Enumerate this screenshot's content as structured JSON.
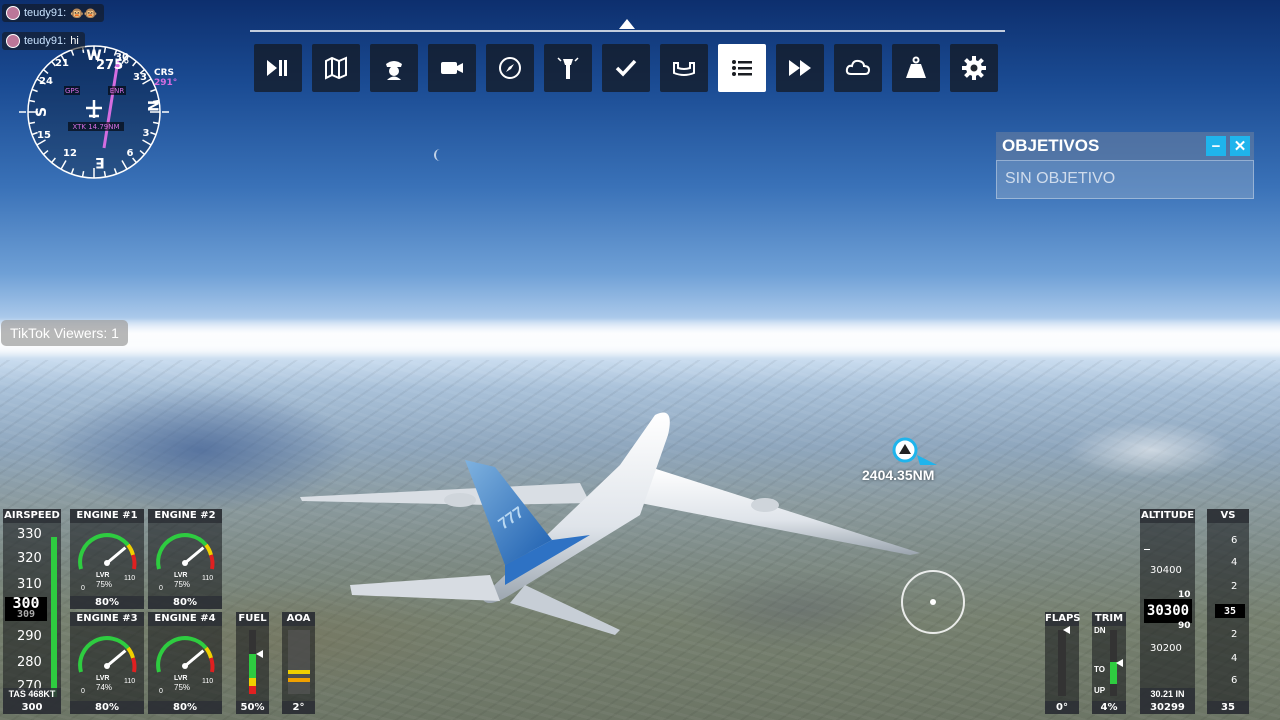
{
  "chat": [
    {
      "user": "teudy91:",
      "text": "🐵🐵"
    },
    {
      "user": "teudy91:",
      "text": "hi"
    }
  ],
  "compass": {
    "heading": "275°",
    "crs_label": "CRS",
    "crs_value": "291°",
    "gps": "GPS",
    "enr": "ENR",
    "xtk": "XTK 14.79NM",
    "cardinals": [
      "N",
      "E",
      "S",
      "W"
    ],
    "numbers": [
      "3",
      "6",
      "12",
      "15",
      "21",
      "24",
      "30",
      "33"
    ]
  },
  "toolbar": {
    "buttons": [
      {
        "name": "pause-button",
        "icon": "play-pause-icon"
      },
      {
        "name": "map-button",
        "icon": "map-icon"
      },
      {
        "name": "atc-button",
        "icon": "pilot-icon"
      },
      {
        "name": "camera-button",
        "icon": "camera-icon"
      },
      {
        "name": "navlog-button",
        "icon": "compass-icon"
      },
      {
        "name": "atc-tower-button",
        "icon": "tower-icon"
      },
      {
        "name": "checklist-button",
        "icon": "check-icon"
      },
      {
        "name": "controls-button",
        "icon": "yoke-icon"
      },
      {
        "name": "objectives-button",
        "icon": "list-icon",
        "active": true
      },
      {
        "name": "sim-rate-button",
        "icon": "fast-forward-icon"
      },
      {
        "name": "weather-button",
        "icon": "cloud-icon"
      },
      {
        "name": "weight-button",
        "icon": "weight-icon"
      },
      {
        "name": "settings-button",
        "icon": "gear-icon"
      }
    ]
  },
  "tiktok": "TikTok Viewers: 1",
  "objectives": {
    "title": "OBJETIVOS",
    "minimize": "−",
    "close": "✕",
    "body": "SIN OBJETIVO"
  },
  "waypoint": {
    "distance": "2404.35NM"
  },
  "airspeed": {
    "title": "AIRSPEED",
    "ticks": [
      "330",
      "320",
      "310",
      "290",
      "280",
      "270"
    ],
    "current": "300",
    "next": "309",
    "tas": "TAS 468KT",
    "value": "300"
  },
  "engines": [
    {
      "title": "ENGINE #1",
      "lvr": "LVR",
      "pct": "75%",
      "min": "0",
      "max": "110",
      "value": "80%",
      "n1": 0.8
    },
    {
      "title": "ENGINE #2",
      "lvr": "LVR",
      "pct": "75%",
      "min": "0",
      "max": "110",
      "value": "80%",
      "n1": 0.8
    },
    {
      "title": "ENGINE #3",
      "lvr": "LVR",
      "pct": "74%",
      "min": "0",
      "max": "110",
      "value": "80%",
      "n1": 0.8
    },
    {
      "title": "ENGINE #4",
      "lvr": "LVR",
      "pct": "75%",
      "min": "0",
      "max": "110",
      "value": "80%",
      "n1": 0.8
    }
  ],
  "fuel": {
    "title": "FUEL",
    "value": "50%",
    "level": 0.5
  },
  "aoa": {
    "title": "AOA",
    "value": "2°"
  },
  "flaps": {
    "title": "FLAPS",
    "value": "0°"
  },
  "trim": {
    "title": "TRIM",
    "dn": "DN",
    "to": "TO",
    "up": "UP",
    "value": "4%"
  },
  "altitude": {
    "title": "ALTITUDE",
    "ticks": [
      "30400",
      "30200"
    ],
    "current": "30300",
    "roll_top": "10",
    "roll_bottom": "90",
    "baro": "30.21 IN",
    "value": "30299"
  },
  "vs": {
    "title": "VS",
    "ticks": [
      "6",
      "4",
      "2",
      "2",
      "4",
      "6"
    ],
    "current": "35",
    "value": "35"
  },
  "colors": {
    "accent": "#1fb4ec",
    "gauge_green": "#2ecc40",
    "gauge_yellow": "#f0d000",
    "gauge_red": "#e02020",
    "magenta": "#d46de0"
  }
}
